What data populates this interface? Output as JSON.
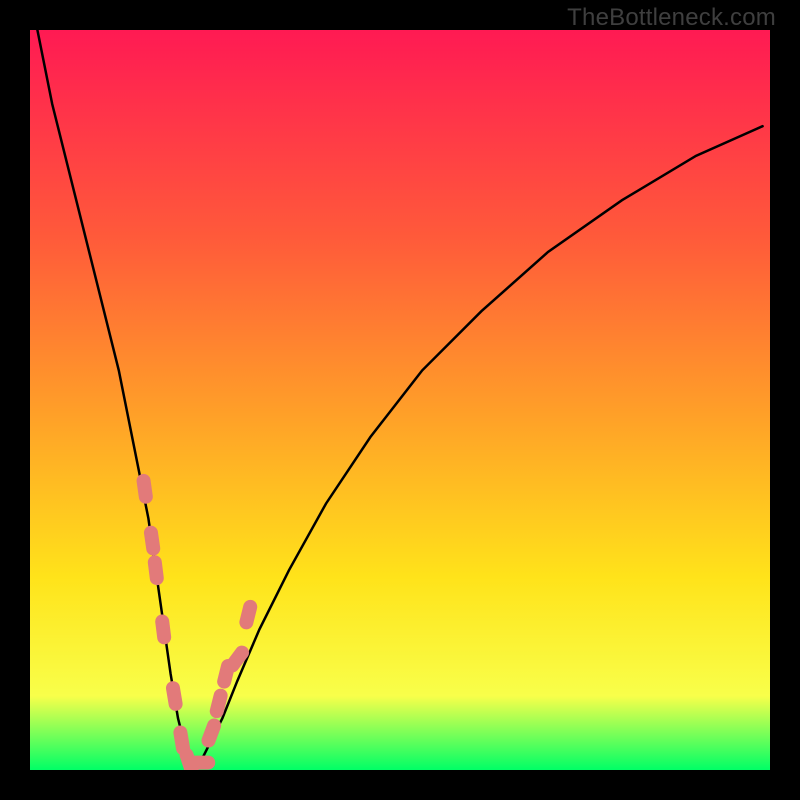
{
  "watermark": "TheBottleneck.com",
  "gradient": {
    "top": "#ff1a53",
    "q1": "#ff5a3a",
    "mid": "#ffa028",
    "q3": "#ffe31a",
    "q4": "#f8ff4a",
    "bottom": "#00ff66"
  },
  "curve_color": "#000000",
  "marker_color": "#e27a7a",
  "chart_data": {
    "type": "line",
    "title": "",
    "xlabel": "",
    "ylabel": "",
    "xlim": [
      0,
      100
    ],
    "ylim": [
      0,
      100
    ],
    "series": [
      {
        "name": "bottleneck-curve",
        "x": [
          1,
          3,
          6,
          9,
          12,
          14,
          16,
          17,
          18,
          19,
          20,
          21,
          22,
          23,
          24,
          26,
          28,
          31,
          35,
          40,
          46,
          53,
          61,
          70,
          80,
          90,
          99
        ],
        "y": [
          100,
          90,
          78,
          66,
          54,
          44,
          34,
          27,
          20,
          13,
          7,
          3,
          1,
          1,
          3,
          7,
          12,
          19,
          27,
          36,
          45,
          54,
          62,
          70,
          77,
          83,
          87
        ]
      }
    ],
    "markers": {
      "name": "highlighted-points",
      "x": [
        15.5,
        16.5,
        17.0,
        18.0,
        19.5,
        20.5,
        21.5,
        23.0,
        24.5,
        25.5,
        26.5,
        28.0,
        29.5
      ],
      "y": [
        38,
        31,
        27,
        19,
        10,
        4,
        1,
        1,
        5,
        9,
        13,
        15,
        21
      ]
    }
  }
}
